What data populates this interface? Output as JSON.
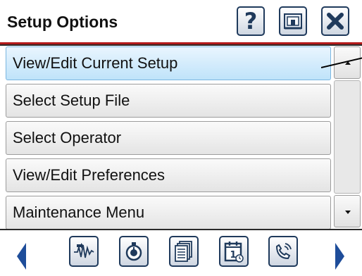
{
  "header": {
    "title": "Setup Options",
    "help_label": "?",
    "icons": [
      "help-icon",
      "home-icon",
      "close-icon"
    ]
  },
  "menu": {
    "items": [
      {
        "label": "View/Edit Current Setup",
        "selected": true
      },
      {
        "label": "Select Setup File",
        "selected": false
      },
      {
        "label": "Select Operator",
        "selected": false
      },
      {
        "label": "View/Edit Preferences",
        "selected": false
      },
      {
        "label": "Maintenance Menu",
        "selected": false
      }
    ]
  },
  "toolbar": {
    "icons": [
      "waveform-icon",
      "stopwatch-icon",
      "documents-icon",
      "calendar-icon",
      "phone-icon"
    ]
  },
  "colors": {
    "accent_red": "#b31b1b",
    "icon_blue": "#1e4d9a",
    "selected_row": "#bfe3fa"
  }
}
